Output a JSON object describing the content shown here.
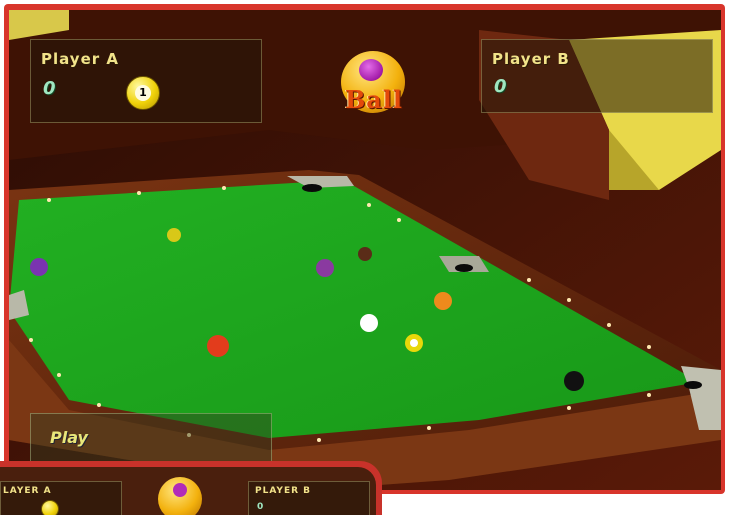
{
  "hud": {
    "player_a": {
      "name": "Player A",
      "score": "0",
      "ball_number": "1"
    },
    "player_b": {
      "name": "Player B",
      "score": "0"
    },
    "emblem_text": "Ball",
    "play_label": "Play"
  },
  "thumbnail": {
    "player_a_name": "LAYER A",
    "player_b_name": "PLAYER B",
    "player_b_score": "0"
  },
  "colors": {
    "felt": "#1ea81e",
    "rail": "#6a2a10",
    "frame": "#d8352b",
    "hud_text": "#f2e38a"
  },
  "balls": [
    {
      "name": "cue-ball",
      "color": "#ffffff"
    },
    {
      "name": "yellow-striped-ball",
      "color": "#e8d80a"
    },
    {
      "name": "yellow-ball",
      "color": "#d8c818"
    },
    {
      "name": "purple-ball",
      "color": "#8a3aa0"
    },
    {
      "name": "purple-ball",
      "color": "#7a34b0"
    },
    {
      "name": "orange-ball",
      "color": "#ee8a1c"
    },
    {
      "name": "red-ball",
      "color": "#e23c1c"
    },
    {
      "name": "brown-ball",
      "color": "#5a2c18"
    },
    {
      "name": "black-ball",
      "color": "#111111"
    }
  ]
}
